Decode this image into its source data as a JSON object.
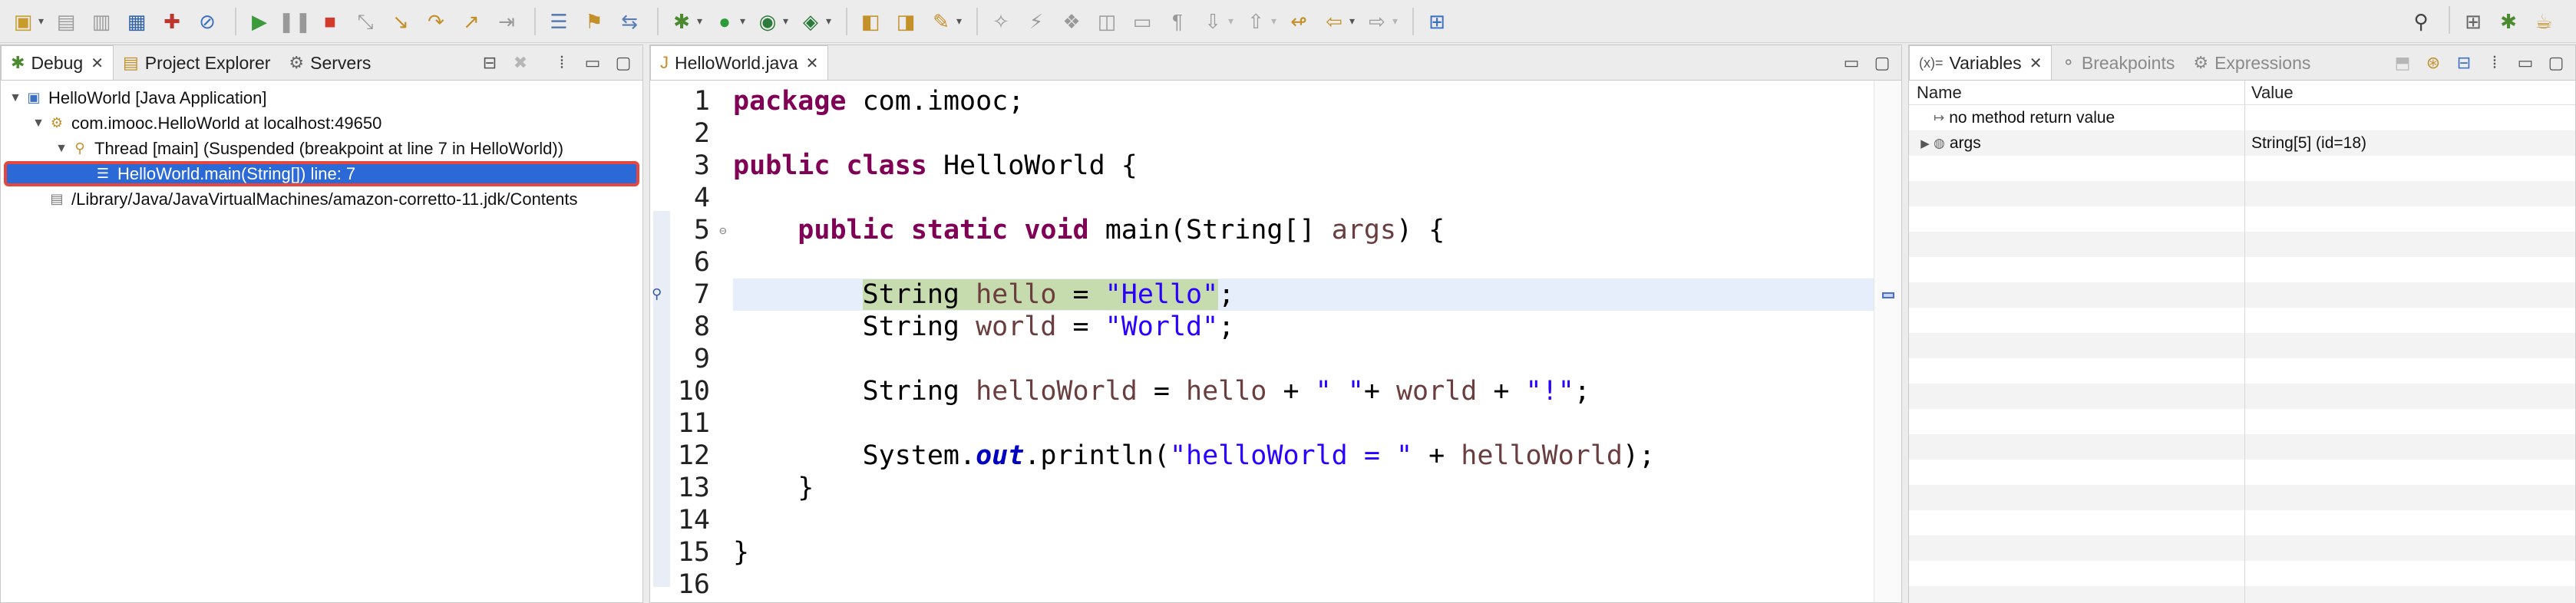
{
  "toolbar": {
    "left_icons": [
      "new-icon",
      "save-icon",
      "save-all-icon",
      "print-icon",
      "gift-icon",
      "skip-breakpoints-icon",
      "resume-icon",
      "suspend-icon",
      "terminate-icon",
      "disconnect-icon",
      "step-into-icon",
      "step-over-icon",
      "step-return-icon",
      "drop-to-frame-icon",
      "use-step-filters-icon",
      "external-tools-icon",
      "debug-icon",
      "run-icon",
      "coverage-icon",
      "run-last-icon",
      "open-type-icon",
      "open-task-icon",
      "search-icon",
      "annotation-icon",
      "next-annotation-icon",
      "prev-annotation-icon",
      "last-edit-icon",
      "back-icon",
      "forward-icon",
      "pin-editor-icon"
    ],
    "right_icons": [
      "search-icon",
      "open-perspective-icon",
      "debug-perspective-icon",
      "java-perspective-icon"
    ]
  },
  "debug_panel": {
    "tabs": [
      {
        "label": "Debug",
        "icon": "bug-icon",
        "active": true
      },
      {
        "label": "Project Explorer",
        "icon": "folder-icon",
        "active": false
      },
      {
        "label": "Servers",
        "icon": "servers-icon",
        "active": false
      }
    ],
    "tree": [
      {
        "label": "HelloWorld [Java Application]",
        "indent": 0,
        "expanded": true,
        "icon": "launch-icon"
      },
      {
        "label": "com.imooc.HelloWorld at localhost:49650",
        "indent": 1,
        "expanded": true,
        "icon": "debug-target-icon"
      },
      {
        "label": "Thread [main] (Suspended (breakpoint at line 7 in HelloWorld))",
        "indent": 2,
        "expanded": true,
        "icon": "thread-icon"
      },
      {
        "label": "HelloWorld.main(String[]) line: 7",
        "indent": 3,
        "expanded": null,
        "icon": "stack-frame-icon",
        "selected": true
      },
      {
        "label": "/Library/Java/JavaVirtualMachines/amazon-corretto-11.jdk/Contents",
        "indent": 1,
        "expanded": null,
        "icon": "process-icon"
      }
    ]
  },
  "editor": {
    "tab_label": "HelloWorld.java",
    "current_line": 7,
    "lines": [
      {
        "n": "1",
        "code": [
          {
            "t": "package",
            "c": "kw"
          },
          {
            "t": " com.imooc;",
            "c": ""
          }
        ]
      },
      {
        "n": "2",
        "code": []
      },
      {
        "n": "3",
        "code": [
          {
            "t": "public",
            "c": "kw"
          },
          {
            "t": " ",
            "c": ""
          },
          {
            "t": "class",
            "c": "kw"
          },
          {
            "t": " HelloWorld {",
            "c": ""
          }
        ]
      },
      {
        "n": "4",
        "code": []
      },
      {
        "n": "5",
        "fold": true,
        "code": [
          {
            "t": "    ",
            "c": ""
          },
          {
            "t": "public",
            "c": "kw"
          },
          {
            "t": " ",
            "c": ""
          },
          {
            "t": "static",
            "c": "kw"
          },
          {
            "t": " ",
            "c": ""
          },
          {
            "t": "void",
            "c": "kw"
          },
          {
            "t": " main(String[] ",
            "c": ""
          },
          {
            "t": "args",
            "c": "var"
          },
          {
            "t": ") {",
            "c": ""
          }
        ]
      },
      {
        "n": "6",
        "code": []
      },
      {
        "n": "7",
        "current": true,
        "code": [
          {
            "t": "        ",
            "c": ""
          },
          {
            "t": "String ",
            "c": "hl"
          },
          {
            "t": "hello",
            "c": "var hl"
          },
          {
            "t": " = ",
            "c": "hl"
          },
          {
            "t": "\"Hello\"",
            "c": "str hl"
          },
          {
            "t": ";",
            "c": ""
          }
        ]
      },
      {
        "n": "8",
        "code": [
          {
            "t": "        String ",
            "c": ""
          },
          {
            "t": "world",
            "c": "var"
          },
          {
            "t": " = ",
            "c": ""
          },
          {
            "t": "\"World\"",
            "c": "str"
          },
          {
            "t": ";",
            "c": ""
          }
        ]
      },
      {
        "n": "9",
        "code": []
      },
      {
        "n": "10",
        "code": [
          {
            "t": "        String ",
            "c": ""
          },
          {
            "t": "helloWorld",
            "c": "var"
          },
          {
            "t": " = ",
            "c": ""
          },
          {
            "t": "hello",
            "c": "var"
          },
          {
            "t": " + ",
            "c": ""
          },
          {
            "t": "\" \"",
            "c": "str"
          },
          {
            "t": "+ ",
            "c": ""
          },
          {
            "t": "world",
            "c": "var"
          },
          {
            "t": " + ",
            "c": ""
          },
          {
            "t": "\"!\"",
            "c": "str"
          },
          {
            "t": ";",
            "c": ""
          }
        ]
      },
      {
        "n": "11",
        "code": []
      },
      {
        "n": "12",
        "code": [
          {
            "t": "        System.",
            "c": ""
          },
          {
            "t": "out",
            "c": "fld"
          },
          {
            "t": ".println(",
            "c": ""
          },
          {
            "t": "\"helloWorld = \"",
            "c": "str"
          },
          {
            "t": " + ",
            "c": ""
          },
          {
            "t": "helloWorld",
            "c": "var"
          },
          {
            "t": ");",
            "c": ""
          }
        ]
      },
      {
        "n": "13",
        "code": [
          {
            "t": "    }",
            "c": ""
          }
        ]
      },
      {
        "n": "14",
        "code": []
      },
      {
        "n": "15",
        "code": [
          {
            "t": "}",
            "c": ""
          }
        ]
      },
      {
        "n": "16",
        "code": []
      }
    ]
  },
  "variables_panel": {
    "tabs": [
      {
        "label": "Variables",
        "icon": "variables-icon",
        "active": true
      },
      {
        "label": "Breakpoints",
        "icon": "breakpoints-icon",
        "active": false
      },
      {
        "label": "Expressions",
        "icon": "expressions-icon",
        "active": false
      }
    ],
    "columns": {
      "name": "Name",
      "value": "Value"
    },
    "rows": [
      {
        "name": "no method return value",
        "value": "",
        "icon": "return-value-icon",
        "expandable": false
      },
      {
        "name": "args",
        "value": "String[5]  (id=18)",
        "icon": "local-variable-icon",
        "expandable": true
      }
    ]
  }
}
